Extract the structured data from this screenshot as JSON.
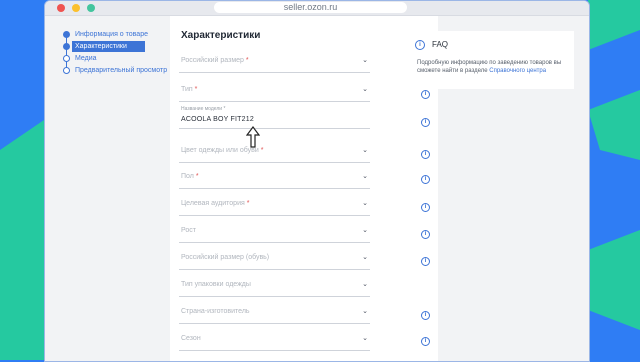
{
  "browser": {
    "url": "seller.ozon.ru"
  },
  "colors": {
    "accent": "#3d74d6",
    "background_blue": "#2f7df4",
    "background_teal": "#25c9a0"
  },
  "sidebar": {
    "items": [
      {
        "label": "Информация о товаре"
      },
      {
        "label": "Характеристики"
      },
      {
        "label": "Медиа"
      },
      {
        "label": "Предварительный просмотр"
      }
    ]
  },
  "main": {
    "title": "Характеристики",
    "fields": [
      {
        "label": "Российский размер",
        "required": "*"
      },
      {
        "label": "Тип",
        "required": "*"
      },
      {
        "small_label": "Название модели",
        "required": "*",
        "value": "ACOOLA BOY FIT212"
      },
      {
        "label": "Цвет одежды или обуви",
        "required": "*"
      },
      {
        "label": "Пол",
        "required": "*"
      },
      {
        "label": "Целевая аудитория",
        "required": "*"
      },
      {
        "label": "Рост",
        "required": ""
      },
      {
        "label": "Российский размер (обувь)",
        "required": ""
      },
      {
        "label": "Тип упаковки одежды",
        "required": ""
      },
      {
        "label": "Страна-изготовитель",
        "required": ""
      },
      {
        "label": "Сезон",
        "required": ""
      }
    ]
  },
  "faq": {
    "title": "FAQ",
    "text": "Подробную информацию по заведению товаров вы сможете найти в разделе",
    "link": "Справочного центра"
  },
  "icons": {
    "info": "info-icon",
    "dropdown": "chevron-down-icon",
    "cursor": "arrow-cursor-icon"
  }
}
